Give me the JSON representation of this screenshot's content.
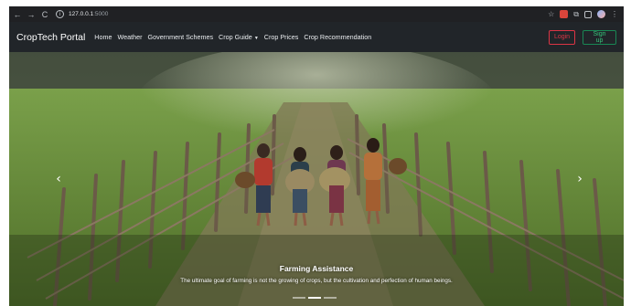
{
  "browser": {
    "url_host": "127.0.0.1",
    "url_port": ":5000"
  },
  "navbar": {
    "brand": "CropTech Portal",
    "links": [
      "Home",
      "Weather",
      "Government Schemes",
      "Crop Guide",
      "Crop Prices",
      "Crop Recommendation"
    ],
    "login_label": "Login",
    "signup_label": "Sign up",
    "colors": {
      "login": "#dc3545",
      "signup": "#198754",
      "bar": "#212529"
    }
  },
  "carousel": {
    "caption_title": "Farming Assistance",
    "caption_text": "The ultimate goal of farming is not the growing of crops, but the cultivation and perfection of human beings.",
    "prev_icon": "chevron-left-icon",
    "next_icon": "chevron-right-icon",
    "slide_count": 3,
    "active_slide": 2
  }
}
